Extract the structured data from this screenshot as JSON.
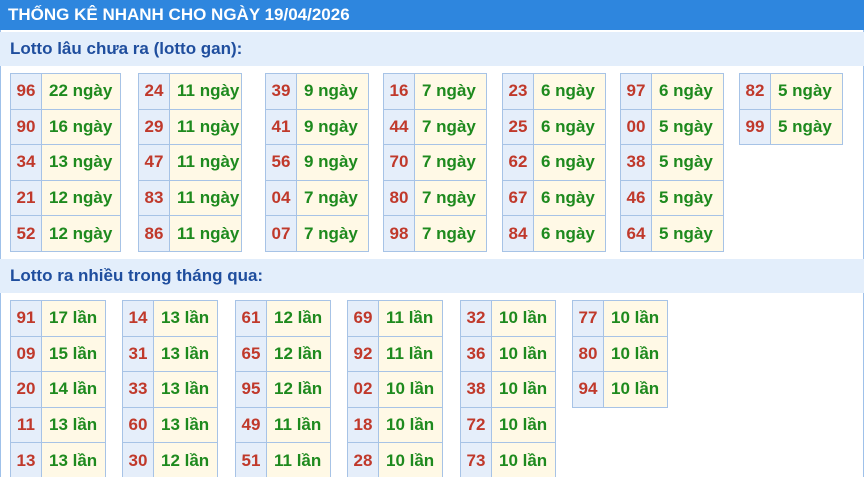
{
  "header": {
    "title": "THỐNG KÊ NHANH CHO NGÀY 19/04/2026"
  },
  "gan": {
    "title": "Lotto lâu chưa ra (lotto gan):",
    "groups": [
      [
        {
          "num": "96",
          "val": "22 ngày"
        },
        {
          "num": "90",
          "val": "16 ngày"
        },
        {
          "num": "34",
          "val": "13 ngày"
        },
        {
          "num": "21",
          "val": "12 ngày"
        },
        {
          "num": "52",
          "val": "12 ngày"
        }
      ],
      [
        {
          "num": "24",
          "val": "11 ngày"
        },
        {
          "num": "29",
          "val": "11 ngày"
        },
        {
          "num": "47",
          "val": "11 ngày"
        },
        {
          "num": "83",
          "val": "11 ngày"
        },
        {
          "num": "86",
          "val": "11 ngày"
        }
      ],
      [
        {
          "num": "39",
          "val": "9 ngày"
        },
        {
          "num": "41",
          "val": "9 ngày"
        },
        {
          "num": "56",
          "val": "9 ngày"
        },
        {
          "num": "04",
          "val": "7 ngày"
        },
        {
          "num": "07",
          "val": "7 ngày"
        }
      ],
      [
        {
          "num": "16",
          "val": "7 ngày"
        },
        {
          "num": "44",
          "val": "7 ngày"
        },
        {
          "num": "70",
          "val": "7 ngày"
        },
        {
          "num": "80",
          "val": "7 ngày"
        },
        {
          "num": "98",
          "val": "7 ngày"
        }
      ],
      [
        {
          "num": "23",
          "val": "6 ngày"
        },
        {
          "num": "25",
          "val": "6 ngày"
        },
        {
          "num": "62",
          "val": "6 ngày"
        },
        {
          "num": "67",
          "val": "6 ngày"
        },
        {
          "num": "84",
          "val": "6 ngày"
        }
      ],
      [
        {
          "num": "97",
          "val": "6 ngày"
        },
        {
          "num": "00",
          "val": "5 ngày"
        },
        {
          "num": "38",
          "val": "5 ngày"
        },
        {
          "num": "46",
          "val": "5 ngày"
        },
        {
          "num": "64",
          "val": "5 ngày"
        }
      ],
      [
        {
          "num": "82",
          "val": "5 ngày"
        },
        {
          "num": "99",
          "val": "5 ngày"
        }
      ]
    ]
  },
  "nhieu": {
    "title": "Lotto ra nhiều trong tháng qua:",
    "groups": [
      [
        {
          "num": "91",
          "val": "17 lần"
        },
        {
          "num": "09",
          "val": "15 lần"
        },
        {
          "num": "20",
          "val": "14 lần"
        },
        {
          "num": "11",
          "val": "13 lần"
        },
        {
          "num": "13",
          "val": "13 lần"
        }
      ],
      [
        {
          "num": "14",
          "val": "13 lần"
        },
        {
          "num": "31",
          "val": "13 lần"
        },
        {
          "num": "33",
          "val": "13 lần"
        },
        {
          "num": "60",
          "val": "13 lần"
        },
        {
          "num": "30",
          "val": "12 lần"
        }
      ],
      [
        {
          "num": "61",
          "val": "12 lần"
        },
        {
          "num": "65",
          "val": "12 lần"
        },
        {
          "num": "95",
          "val": "12 lần"
        },
        {
          "num": "49",
          "val": "11 lần"
        },
        {
          "num": "51",
          "val": "11 lần"
        }
      ],
      [
        {
          "num": "69",
          "val": "11 lần"
        },
        {
          "num": "92",
          "val": "11 lần"
        },
        {
          "num": "02",
          "val": "10 lần"
        },
        {
          "num": "18",
          "val": "10 lần"
        },
        {
          "num": "28",
          "val": "10 lần"
        }
      ],
      [
        {
          "num": "32",
          "val": "10 lần"
        },
        {
          "num": "36",
          "val": "10 lần"
        },
        {
          "num": "38",
          "val": "10 lần"
        },
        {
          "num": "72",
          "val": "10 lần"
        },
        {
          "num": "73",
          "val": "10 lần"
        }
      ],
      [
        {
          "num": "77",
          "val": "10 lần"
        },
        {
          "num": "80",
          "val": "10 lần"
        },
        {
          "num": "94",
          "val": "10 lần"
        }
      ]
    ]
  },
  "colors": {
    "header_bg": "#2e86de",
    "section_bg": "#e3eefb",
    "number": "#c0392b",
    "value": "#1e8a1e",
    "number_cell_bg": "#e5eefa",
    "value_cell_bg": "#fff9e6"
  }
}
